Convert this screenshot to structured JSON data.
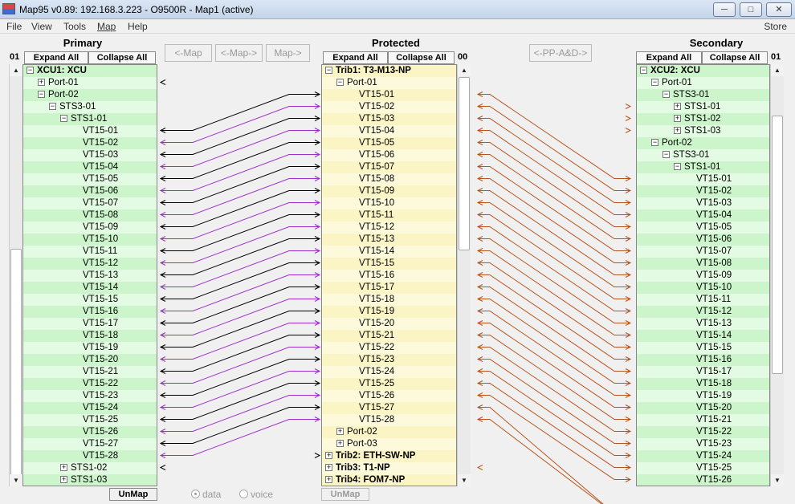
{
  "window": {
    "title": "Map95 v0.89: 192.168.3.223 - O9500R - Map1 (active)"
  },
  "menu": {
    "items": [
      "File",
      "View",
      "Tools",
      "Map",
      "Help"
    ],
    "store": "Store"
  },
  "colors": {
    "purple": "#9b30c8",
    "black": "#000000",
    "orange": "#b8541b"
  },
  "primary": {
    "title": "Primary",
    "corner": "01",
    "expand_all": "Expand All",
    "collapse_all": "Collapse All",
    "tree": [
      {
        "t": "XCU1: XCU",
        "e": "-",
        "b": true
      },
      {
        "t": "Port-01",
        "e": "+"
      },
      {
        "t": "Port-02",
        "e": "-"
      },
      {
        "t": "STS3-01",
        "e": "-"
      },
      {
        "t": "STS1-01",
        "e": "-"
      },
      {
        "t": "VT15-01"
      },
      {
        "t": "VT15-02"
      },
      {
        "t": "VT15-03"
      },
      {
        "t": "VT15-04"
      },
      {
        "t": "VT15-05"
      },
      {
        "t": "VT15-06"
      },
      {
        "t": "VT15-07"
      },
      {
        "t": "VT15-08"
      },
      {
        "t": "VT15-09"
      },
      {
        "t": "VT15-10"
      },
      {
        "t": "VT15-11"
      },
      {
        "t": "VT15-12"
      },
      {
        "t": "VT15-13"
      },
      {
        "t": "VT15-14"
      },
      {
        "t": "VT15-15"
      },
      {
        "t": "VT15-16"
      },
      {
        "t": "VT15-17"
      },
      {
        "t": "VT15-18"
      },
      {
        "t": "VT15-19"
      },
      {
        "t": "VT15-20"
      },
      {
        "t": "VT15-21"
      },
      {
        "t": "VT15-22"
      },
      {
        "t": "VT15-23"
      },
      {
        "t": "VT15-24"
      },
      {
        "t": "VT15-25"
      },
      {
        "t": "VT15-26"
      },
      {
        "t": "VT15-27"
      },
      {
        "t": "VT15-28"
      },
      {
        "t": "STS1-02",
        "e": "+"
      },
      {
        "t": "STS1-03",
        "e": "+"
      }
    ],
    "unmap": "UnMap"
  },
  "map_buttons": {
    "map_left": "<-Map",
    "map_both": "<-Map->",
    "map_right": "Map->",
    "pp": "<-PP-A&D->"
  },
  "protected": {
    "title": "Protected",
    "corner": "00",
    "expand_all": "Expand All",
    "collapse_all": "Collapse All",
    "tree": [
      {
        "t": "Trib1: T3-M13-NP",
        "e": "-",
        "b": true
      },
      {
        "t": "Port-01",
        "e": "-"
      },
      {
        "t": "VT15-01"
      },
      {
        "t": "VT15-02"
      },
      {
        "t": "VT15-03"
      },
      {
        "t": "VT15-04"
      },
      {
        "t": "VT15-05"
      },
      {
        "t": "VT15-06"
      },
      {
        "t": "VT15-07"
      },
      {
        "t": "VT15-08"
      },
      {
        "t": "VT15-09"
      },
      {
        "t": "VT15-10"
      },
      {
        "t": "VT15-11"
      },
      {
        "t": "VT15-12"
      },
      {
        "t": "VT15-13"
      },
      {
        "t": "VT15-14"
      },
      {
        "t": "VT15-15"
      },
      {
        "t": "VT15-16"
      },
      {
        "t": "VT15-17"
      },
      {
        "t": "VT15-18"
      },
      {
        "t": "VT15-19"
      },
      {
        "t": "VT15-20"
      },
      {
        "t": "VT15-21"
      },
      {
        "t": "VT15-22"
      },
      {
        "t": "VT15-23"
      },
      {
        "t": "VT15-24"
      },
      {
        "t": "VT15-25"
      },
      {
        "t": "VT15-26"
      },
      {
        "t": "VT15-27"
      },
      {
        "t": "VT15-28"
      },
      {
        "t": "Port-02",
        "e": "+"
      },
      {
        "t": "Port-03",
        "e": "+"
      },
      {
        "t": "Trib2: ETH-SW-NP",
        "e": "+",
        "b": true
      },
      {
        "t": "Trib3: T1-NP",
        "e": "+",
        "b": true
      },
      {
        "t": "Trib4: FOM7-NP",
        "e": "+",
        "b": true
      }
    ],
    "unmap": "UnMap",
    "radio_data": "data",
    "radio_voice": "voice"
  },
  "secondary": {
    "title": "Secondary",
    "corner": "01",
    "expand_all": "Expand All",
    "collapse_all": "Collapse All",
    "tree": [
      {
        "t": "XCU2: XCU",
        "e": "-",
        "b": true
      },
      {
        "t": "Port-01",
        "e": "-"
      },
      {
        "t": "STS3-01",
        "e": "-"
      },
      {
        "t": "STS1-01",
        "e": "+"
      },
      {
        "t": "STS1-02",
        "e": "+"
      },
      {
        "t": "STS1-03",
        "e": "+"
      },
      {
        "t": "Port-02",
        "e": "-"
      },
      {
        "t": "STS3-01",
        "e": "-"
      },
      {
        "t": "STS1-01",
        "e": "-"
      },
      {
        "t": "VT15-01"
      },
      {
        "t": "VT15-02"
      },
      {
        "t": "VT15-03"
      },
      {
        "t": "VT15-04"
      },
      {
        "t": "VT15-05"
      },
      {
        "t": "VT15-06"
      },
      {
        "t": "VT15-07"
      },
      {
        "t": "VT15-08"
      },
      {
        "t": "VT15-09"
      },
      {
        "t": "VT15-10"
      },
      {
        "t": "VT15-11"
      },
      {
        "t": "VT15-12"
      },
      {
        "t": "VT15-13"
      },
      {
        "t": "VT15-14"
      },
      {
        "t": "VT15-15"
      },
      {
        "t": "VT15-16"
      },
      {
        "t": "VT15-17"
      },
      {
        "t": "VT15-18"
      },
      {
        "t": "VT15-19"
      },
      {
        "t": "VT15-20"
      },
      {
        "t": "VT15-21"
      },
      {
        "t": "VT15-22"
      },
      {
        "t": "VT15-23"
      },
      {
        "t": "VT15-24"
      },
      {
        "t": "VT15-25"
      },
      {
        "t": "VT15-26"
      }
    ]
  }
}
